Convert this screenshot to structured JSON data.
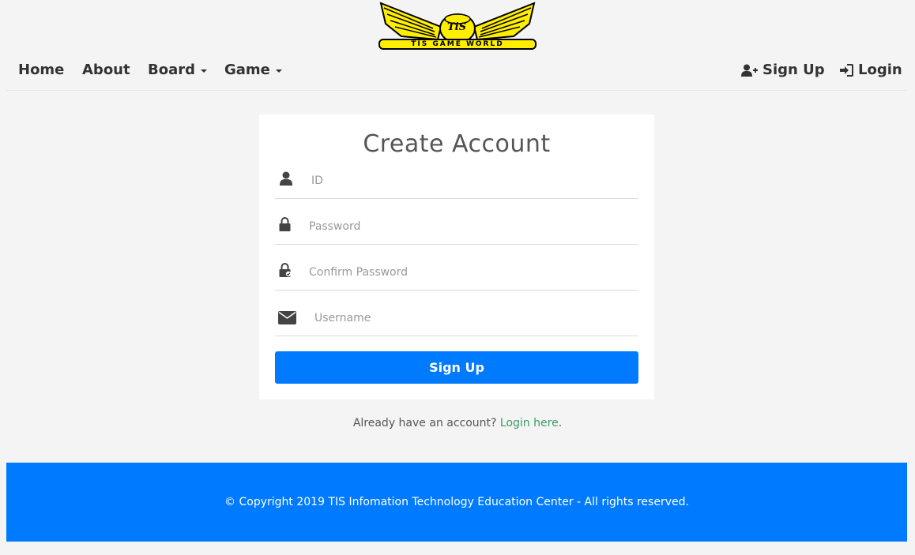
{
  "logo": {
    "text": "TIS GAME WORLD",
    "initials": "TiS",
    "colors": {
      "wing": "#ffee00",
      "outline": "#000000"
    }
  },
  "nav": {
    "left": [
      {
        "label": "Home"
      },
      {
        "label": "About"
      },
      {
        "label": "Board",
        "dropdown": true
      },
      {
        "label": "Game",
        "dropdown": true
      }
    ],
    "right": [
      {
        "label": "Sign Up",
        "icon": "user-plus-icon"
      },
      {
        "label": "Login",
        "icon": "sign-in-icon"
      }
    ]
  },
  "form": {
    "title": "Create Account",
    "fields": [
      {
        "icon": "user-icon",
        "placeholder": "ID",
        "value": ""
      },
      {
        "icon": "lock-icon",
        "placeholder": "Password",
        "value": ""
      },
      {
        "icon": "lock-check-icon",
        "placeholder": "Confirm Password",
        "value": ""
      },
      {
        "icon": "envelope-icon",
        "placeholder": "Username",
        "value": ""
      }
    ],
    "submit_label": "Sign Up"
  },
  "login_prompt": {
    "text": "Already have an account?",
    "link_text": "Login here",
    "suffix": "."
  },
  "footer": {
    "text": "© Copyright 2019 TIS Infomation Technology Education Center - All rights reserved."
  },
  "colors": {
    "primary": "#007bff",
    "link": "#3a9a63",
    "background": "#f4f4f4"
  }
}
